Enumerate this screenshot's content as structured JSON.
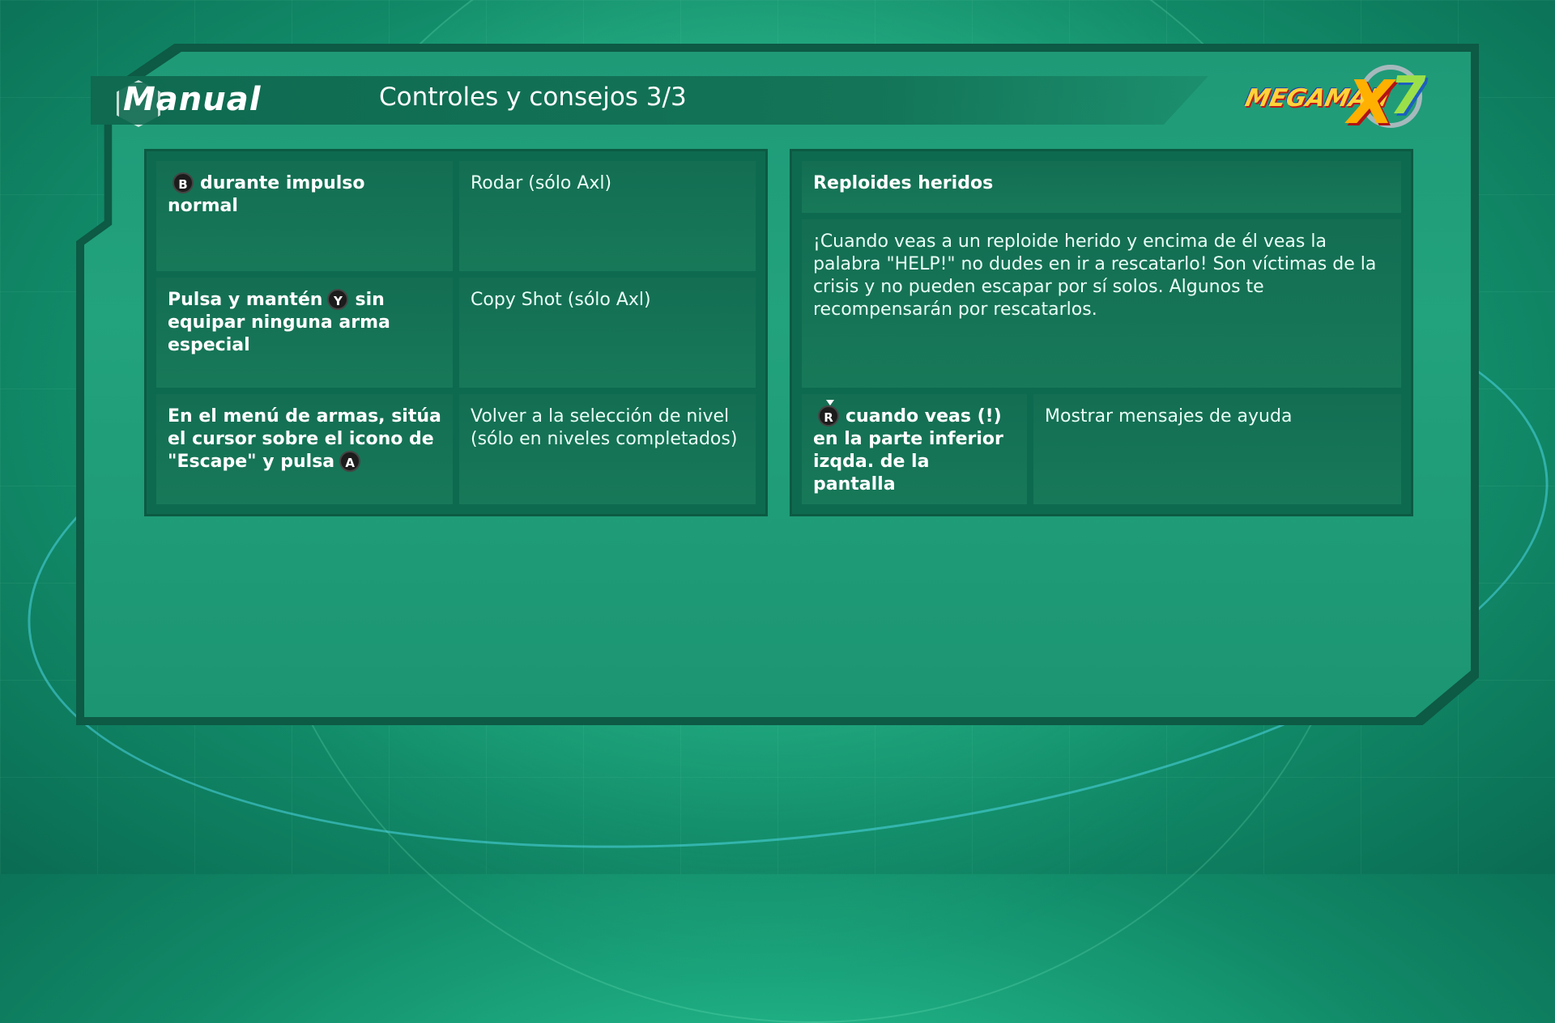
{
  "header": {
    "manual_label": "Manual",
    "section_title": "Controles y consejos 3/3"
  },
  "logo": {
    "name_text": "MEGAMAN",
    "x_text": "X",
    "number_text": "7"
  },
  "left_table": {
    "rows": [
      {
        "button": "B",
        "key_after": "durante impulso normal",
        "desc": "Rodar (sólo Axl)"
      },
      {
        "key_before": "Pulsa y mantén",
        "button": "Y",
        "key_after": "sin equipar ninguna arma especial",
        "desc": "Copy Shot (sólo Axl)"
      },
      {
        "key_before": "En el menú de armas, sitúa el cursor sobre el icono de \"Escape\" y pulsa",
        "button": "A",
        "desc": "Volver a la selección de nivel (sólo en niveles completados)"
      }
    ]
  },
  "right_table": {
    "heading": "Reploides heridos",
    "body": "¡Cuando veas a un reploide herido y encima de él veas la palabra \"HELP!\" no dudes en ir a rescatarlo! Son víctimas de la crisis y no pueden escapar por sí solos. Algunos te recompensarán por rescatarlos.",
    "row": {
      "button": "R",
      "key_after": "cuando veas (!) en la parte inferior izqda. de la pantalla",
      "desc": "Mostrar mensajes de ayuda"
    }
  },
  "colors": {
    "background": "#1fae83",
    "panel": "#0e6a4f",
    "cell": "#167a5a",
    "text": "#ffffff"
  }
}
